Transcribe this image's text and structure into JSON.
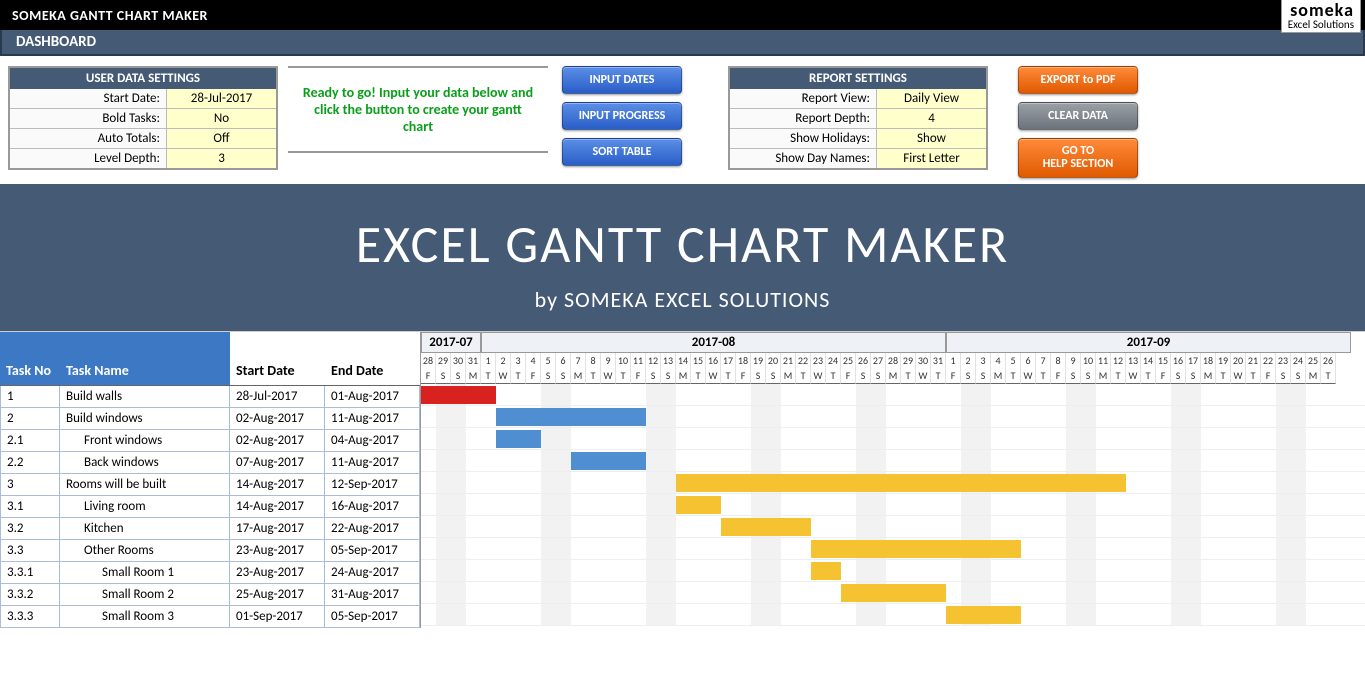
{
  "titlebar": {
    "title": "SOMEKA GANTT CHART MAKER"
  },
  "logo": {
    "big": "someka",
    "small": "Excel Solutions"
  },
  "dashboard_label": "DASHBOARD",
  "user_settings": {
    "header": "USER DATA SETTINGS",
    "rows": [
      {
        "label": "Start Date:",
        "value": "28-Jul-2017"
      },
      {
        "label": "Bold Tasks:",
        "value": "No"
      },
      {
        "label": "Auto Totals:",
        "value": "Off"
      },
      {
        "label": "Level Depth:",
        "value": "3"
      }
    ]
  },
  "ready_msg": "Ready to go! Input your data below and click the button to create your gantt chart",
  "action_buttons": {
    "input_dates": "INPUT DATES",
    "input_progress": "INPUT PROGRESS",
    "sort_table": "SORT TABLE"
  },
  "report_settings": {
    "header": "REPORT SETTINGS",
    "rows": [
      {
        "label": "Report View:",
        "value": "Daily View"
      },
      {
        "label": "Report Depth:",
        "value": "4"
      },
      {
        "label": "Show Holidays:",
        "value": "Show"
      },
      {
        "label": "Show Day Names:",
        "value": "First Letter"
      }
    ]
  },
  "secondary_buttons": {
    "export_pdf": "EXPORT to PDF",
    "clear_data": "CLEAR DATA",
    "help": "GO TO\nHELP SECTION"
  },
  "hero": {
    "title": "EXCEL GANTT CHART MAKER",
    "subtitle": "by SOMEKA EXCEL SOLUTIONS"
  },
  "columns": {
    "task_no": "Task No",
    "task_name": "Task Name",
    "start_date": "Start Date",
    "end_date": "End Date"
  },
  "chart_data": {
    "type": "gantt",
    "start_date": "2017-07-28",
    "months": [
      {
        "label": "2017-07",
        "days": 4
      },
      {
        "label": "2017-08",
        "days": 31
      },
      {
        "label": "2017-09",
        "days": 27
      }
    ],
    "days": [
      {
        "n": 28,
        "l": "F"
      },
      {
        "n": 29,
        "l": "S"
      },
      {
        "n": 30,
        "l": "S"
      },
      {
        "n": 31,
        "l": "M"
      },
      {
        "n": 1,
        "l": "T"
      },
      {
        "n": 2,
        "l": "W"
      },
      {
        "n": 3,
        "l": "T"
      },
      {
        "n": 4,
        "l": "F"
      },
      {
        "n": 5,
        "l": "S"
      },
      {
        "n": 6,
        "l": "S"
      },
      {
        "n": 7,
        "l": "M"
      },
      {
        "n": 8,
        "l": "T"
      },
      {
        "n": 9,
        "l": "W"
      },
      {
        "n": 10,
        "l": "T"
      },
      {
        "n": 11,
        "l": "F"
      },
      {
        "n": 12,
        "l": "S"
      },
      {
        "n": 13,
        "l": "S"
      },
      {
        "n": 14,
        "l": "M"
      },
      {
        "n": 15,
        "l": "T"
      },
      {
        "n": 16,
        "l": "W"
      },
      {
        "n": 17,
        "l": "T"
      },
      {
        "n": 18,
        "l": "F"
      },
      {
        "n": 19,
        "l": "S"
      },
      {
        "n": 20,
        "l": "S"
      },
      {
        "n": 21,
        "l": "M"
      },
      {
        "n": 22,
        "l": "T"
      },
      {
        "n": 23,
        "l": "W"
      },
      {
        "n": 24,
        "l": "T"
      },
      {
        "n": 25,
        "l": "F"
      },
      {
        "n": 26,
        "l": "S"
      },
      {
        "n": 27,
        "l": "S"
      },
      {
        "n": 28,
        "l": "M"
      },
      {
        "n": 29,
        "l": "T"
      },
      {
        "n": 30,
        "l": "W"
      },
      {
        "n": 31,
        "l": "T"
      },
      {
        "n": 1,
        "l": "F"
      },
      {
        "n": 2,
        "l": "S"
      },
      {
        "n": 3,
        "l": "S"
      },
      {
        "n": 4,
        "l": "M"
      },
      {
        "n": 5,
        "l": "T"
      },
      {
        "n": 6,
        "l": "W"
      },
      {
        "n": 7,
        "l": "T"
      },
      {
        "n": 8,
        "l": "F"
      },
      {
        "n": 9,
        "l": "S"
      },
      {
        "n": 10,
        "l": "S"
      },
      {
        "n": 11,
        "l": "M"
      },
      {
        "n": 12,
        "l": "T"
      },
      {
        "n": 13,
        "l": "W"
      },
      {
        "n": 14,
        "l": "T"
      },
      {
        "n": 15,
        "l": "F"
      },
      {
        "n": 16,
        "l": "S"
      },
      {
        "n": 17,
        "l": "S"
      },
      {
        "n": 18,
        "l": "M"
      },
      {
        "n": 19,
        "l": "T"
      },
      {
        "n": 20,
        "l": "W"
      },
      {
        "n": 21,
        "l": "T"
      },
      {
        "n": 22,
        "l": "F"
      },
      {
        "n": 23,
        "l": "S"
      },
      {
        "n": 24,
        "l": "S"
      },
      {
        "n": 25,
        "l": "M"
      },
      {
        "n": 26,
        "l": "T"
      }
    ],
    "tasks": [
      {
        "no": "1",
        "name": "Build walls",
        "indent": 0,
        "start": "28-Jul-2017",
        "end": "01-Aug-2017",
        "offset": 0,
        "span": 5,
        "color": "red"
      },
      {
        "no": "2",
        "name": "Build windows",
        "indent": 0,
        "start": "02-Aug-2017",
        "end": "11-Aug-2017",
        "offset": 5,
        "span": 10,
        "color": "blue"
      },
      {
        "no": "2.1",
        "name": "Front windows",
        "indent": 1,
        "start": "02-Aug-2017",
        "end": "04-Aug-2017",
        "offset": 5,
        "span": 3,
        "color": "blue"
      },
      {
        "no": "2.2",
        "name": "Back windows",
        "indent": 1,
        "start": "07-Aug-2017",
        "end": "11-Aug-2017",
        "offset": 10,
        "span": 5,
        "color": "blue"
      },
      {
        "no": "3",
        "name": "Rooms will be built",
        "indent": 0,
        "start": "14-Aug-2017",
        "end": "12-Sep-2017",
        "offset": 17,
        "span": 30,
        "color": "yellow"
      },
      {
        "no": "3.1",
        "name": "Living room",
        "indent": 1,
        "start": "14-Aug-2017",
        "end": "16-Aug-2017",
        "offset": 17,
        "span": 3,
        "color": "yellow"
      },
      {
        "no": "3.2",
        "name": "Kitchen",
        "indent": 1,
        "start": "17-Aug-2017",
        "end": "22-Aug-2017",
        "offset": 20,
        "span": 6,
        "color": "yellow"
      },
      {
        "no": "3.3",
        "name": "Other Rooms",
        "indent": 1,
        "start": "23-Aug-2017",
        "end": "05-Sep-2017",
        "offset": 26,
        "span": 14,
        "color": "yellow"
      },
      {
        "no": "3.3.1",
        "name": "Small Room 1",
        "indent": 2,
        "start": "23-Aug-2017",
        "end": "24-Aug-2017",
        "offset": 26,
        "span": 2,
        "color": "yellow"
      },
      {
        "no": "3.3.2",
        "name": "Small Room 2",
        "indent": 2,
        "start": "25-Aug-2017",
        "end": "31-Aug-2017",
        "offset": 28,
        "span": 7,
        "color": "yellow"
      },
      {
        "no": "3.3.3",
        "name": "Small Room 3",
        "indent": 2,
        "start": "01-Sep-2017",
        "end": "05-Sep-2017",
        "offset": 35,
        "span": 5,
        "color": "yellow"
      }
    ]
  }
}
